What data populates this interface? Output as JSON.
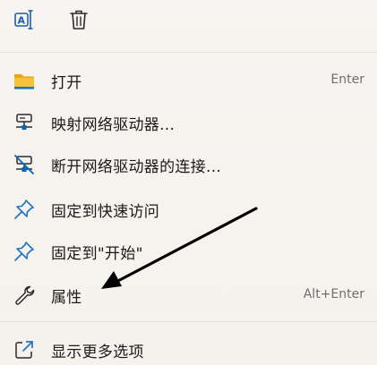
{
  "toolbar": {
    "icons": [
      "rename-icon",
      "delete-icon"
    ]
  },
  "menu_items": [
    {
      "label": "打开",
      "shortcut": "Enter",
      "icon": "folder-icon"
    },
    {
      "label": "映射网络驱动器...",
      "shortcut": "",
      "icon": "map-network-drive-icon"
    },
    {
      "label": "断开网络驱动器的连接...",
      "shortcut": "",
      "icon": "disconnect-network-drive-icon"
    },
    {
      "label": "固定到快速访问",
      "shortcut": "",
      "icon": "pin-icon"
    },
    {
      "label": "固定到\"开始\"",
      "shortcut": "",
      "icon": "pin-icon"
    },
    {
      "label": "属性",
      "shortcut": "Alt+Enter",
      "icon": "wrench-icon"
    },
    {
      "label": "显示更多选项",
      "shortcut": "",
      "icon": "show-more-icon"
    }
  ],
  "colors": {
    "accent": "#0067c0",
    "folder": "#f2b21b",
    "text": "#1b1b1b",
    "shortcut": "#6f6f6f",
    "annotation_arrow": "#000000"
  }
}
